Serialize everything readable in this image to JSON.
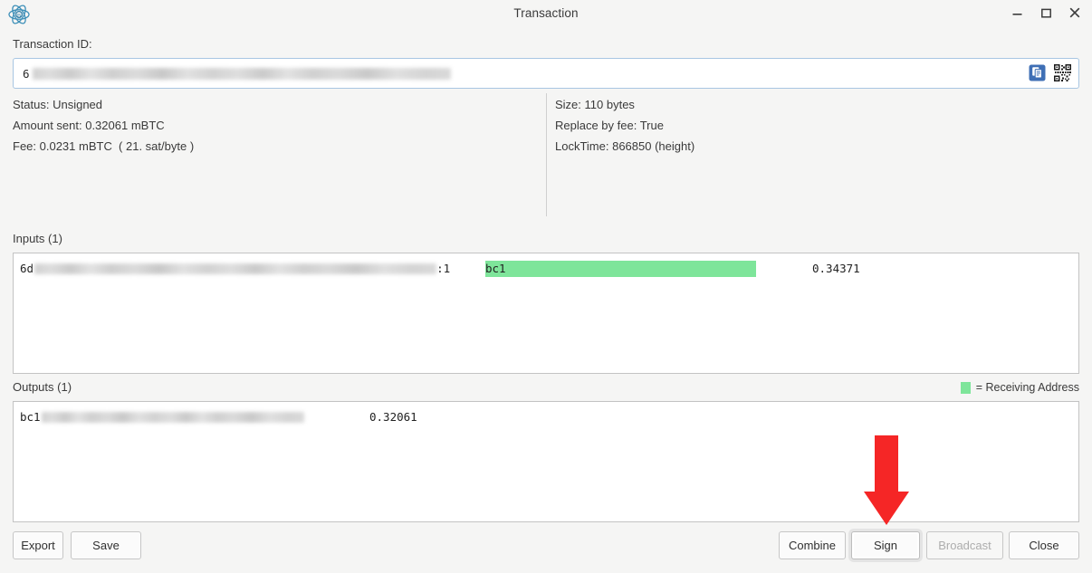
{
  "window": {
    "title": "Transaction",
    "logo_icon": "electrum-logo-icon",
    "controls": [
      {
        "name": "minimize-button",
        "icon": "minimize-icon",
        "label": "–"
      },
      {
        "name": "maximize-button",
        "icon": "maximize-icon",
        "label": "□"
      },
      {
        "name": "close-button",
        "icon": "close-icon",
        "label": "×"
      }
    ]
  },
  "txid": {
    "label": "Transaction ID:",
    "value_prefix": "6",
    "value_redacted": true,
    "copy_icon": "copy-icon",
    "qr_icon": "qr-code-icon"
  },
  "summary_left": [
    "Status: Unsigned",
    "Amount sent: 0.32061 mBTC",
    "Fee: 0.0231 mBTC  ( 21. sat/byte )"
  ],
  "summary_right": [
    "Size: 110 bytes",
    "Replace by fee: True",
    "LockTime: 866850 (height)"
  ],
  "inputs": {
    "label": "Inputs (1)",
    "rows": [
      {
        "txid_prefix": "6d",
        "output_index": ":1",
        "address_prefix": "bc1",
        "address_highlighted": true,
        "amount": "0.34371"
      }
    ]
  },
  "outputs": {
    "label": "Outputs (1)",
    "rows": [
      {
        "address_prefix": "bc1",
        "address_highlighted": false,
        "amount": "0.32061"
      }
    ]
  },
  "legend": {
    "text": "= Receiving Address",
    "color": "#7ee59a"
  },
  "buttons": {
    "export": "Export",
    "save": "Save",
    "combine": "Combine",
    "sign": "Sign",
    "broadcast": "Broadcast",
    "close": "Close"
  },
  "annotation": {
    "arrow_icon": "red-down-arrow-icon",
    "color": "#f52626",
    "points_to": "Sign"
  },
  "colors": {
    "background": "#f5f5f4",
    "accent_blue": "#3b6ea5",
    "highlight_green": "#7ee59a",
    "annotation_red": "#f52626"
  }
}
